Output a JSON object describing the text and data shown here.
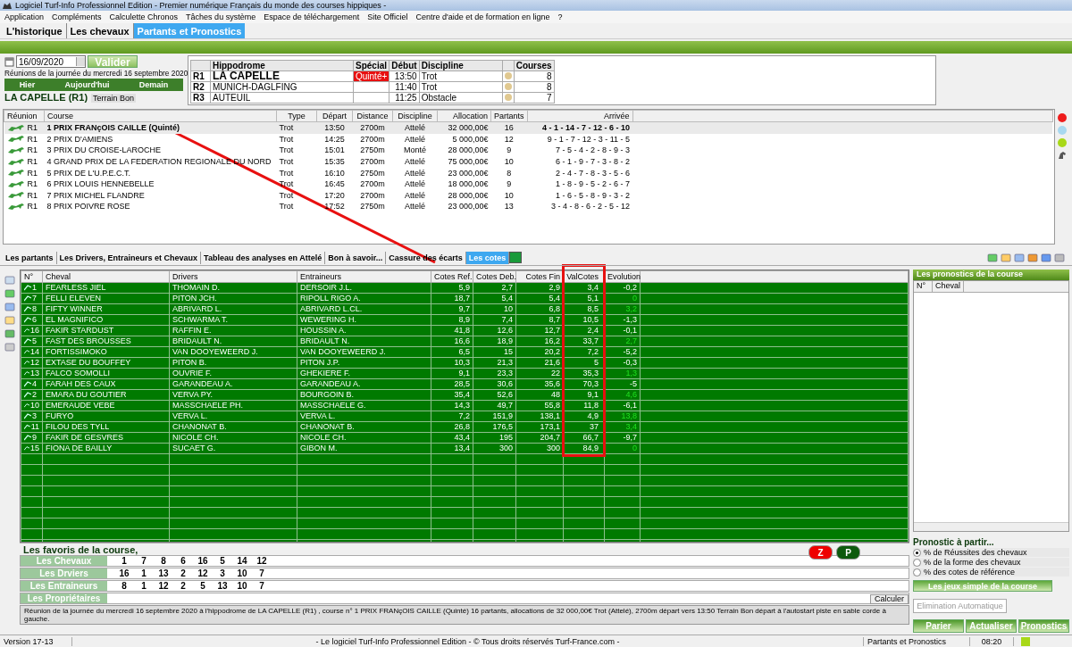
{
  "window": {
    "title": "Logiciel Turf-Info Professionnel Edition - Premier numérique Français du monde des courses hippiques -"
  },
  "menu": [
    "Application",
    "Compléments",
    "Calculette Chronos",
    "Tâches du système",
    "Espace de téléchargement",
    "Site Officiel",
    "Centre d'aide et de formation en ligne",
    "?"
  ],
  "main_tabs": [
    {
      "label": "L'historique",
      "selected": false
    },
    {
      "label": "Les chevaux",
      "selected": false
    },
    {
      "label": "Partants et Pronostics",
      "selected": true
    }
  ],
  "date_field": {
    "value": "16/09/2020",
    "button": "Valider"
  },
  "day_text": "Réunions de la journée du mercredi 16 septembre 2020",
  "day_buttons": [
    "Hier",
    "Aujourd'hui",
    "Demain"
  ],
  "meeting_title": "LA CAPELLE (R1)",
  "terrain": "Terrain Bon",
  "meetings": {
    "columns": [
      "Hippodrome",
      "Spécial",
      "Début",
      "Discipline",
      "Courses"
    ],
    "rows": [
      {
        "code": "R1",
        "hippodrome": "LA CAPELLE",
        "special": "Quinté+",
        "debut": "13:50",
        "discipline": "Trot",
        "color": "#e0c890",
        "courses": "8",
        "selected": true
      },
      {
        "code": "R2",
        "hippodrome": "MUNICH-DAGLFING",
        "debut": "11:40",
        "discipline": "Trot",
        "color": "#e0c890",
        "courses": "8",
        "selected": false
      },
      {
        "code": "R3",
        "hippodrome": "AUTEUIL",
        "debut": "11:25",
        "discipline": "Obstacle",
        "color": "#e0c890",
        "courses": "7",
        "selected": false
      }
    ]
  },
  "races": {
    "columns": [
      "Réunion",
      "Course",
      "Type",
      "Départ",
      "Distance",
      "Discipline",
      "Allocation",
      "Partants",
      "Arrivée"
    ],
    "rows": [
      {
        "reunion": "R1",
        "course": "1 PRIX FRANçOIS CAILLE (Quinté)",
        "type": "Trot",
        "depart": "13:50",
        "distance": "2700m",
        "discipline": "Attelé",
        "allocation": "32 000,00€",
        "partants": "16",
        "arrivee": "4 - 1 - 14 - 7 - 12 - 6 - 10",
        "selected": true
      },
      {
        "reunion": "R1",
        "course": "2 PRIX D'AMIENS",
        "type": "Trot",
        "depart": "14:25",
        "distance": "2700m",
        "discipline": "Attelé",
        "allocation": "5 000,00€",
        "partants": "12",
        "arrivee": "9 - 1 - 7 - 12 - 3 - 11 - 5",
        "selected": false
      },
      {
        "reunion": "R1",
        "course": "3 PRIX DU CROISE-LAROCHE",
        "type": "Trot",
        "depart": "15:01",
        "distance": "2750m",
        "discipline": "Monté",
        "allocation": "28 000,00€",
        "partants": "9",
        "arrivee": "7 - 5 - 4 - 2 - 8 - 9 - 3",
        "selected": false
      },
      {
        "reunion": "R1",
        "course": "4 GRAND PRIX DE LA FEDERATION REGIONALE DU NORD",
        "type": "Trot",
        "depart": "15:35",
        "distance": "2700m",
        "discipline": "Attelé",
        "allocation": "75 000,00€",
        "partants": "10",
        "arrivee": "6 - 1 - 9 - 7 - 3 - 8 - 2",
        "selected": false
      },
      {
        "reunion": "R1",
        "course": "5 PRIX DE L'U.P.E.C.T.",
        "type": "Trot",
        "depart": "16:10",
        "distance": "2750m",
        "discipline": "Attelé",
        "allocation": "23 000,00€",
        "partants": "8",
        "arrivee": "2 - 4 - 7 - 8 - 3 - 5 - 6",
        "selected": false
      },
      {
        "reunion": "R1",
        "course": "6 PRIX LOUIS HENNEBELLE",
        "type": "Trot",
        "depart": "16:45",
        "distance": "2700m",
        "discipline": "Attelé",
        "allocation": "18 000,00€",
        "partants": "9",
        "arrivee": "1 - 8 - 9 - 5 - 2 - 6 - 7",
        "selected": false
      },
      {
        "reunion": "R1",
        "course": "7 PRIX MICHEL FLANDRE",
        "type": "Trot",
        "depart": "17:20",
        "distance": "2700m",
        "discipline": "Attelé",
        "allocation": "28 000,00€",
        "partants": "10",
        "arrivee": "1 - 6 - 5 - 8 - 9 - 3 - 2",
        "selected": false
      },
      {
        "reunion": "R1",
        "course": "8 PRIX POIVRE ROSE",
        "type": "Trot",
        "depart": "17:52",
        "distance": "2750m",
        "discipline": "Attelé",
        "allocation": "23 000,00€",
        "partants": "13",
        "arrivee": "3 - 4 - 8 - 6 - 2 - 5 - 12",
        "selected": false
      }
    ]
  },
  "status_dots": [
    {
      "color": "#ee1c1c"
    },
    {
      "color": "#a8d8f0"
    },
    {
      "color": "#a8d818"
    }
  ],
  "sub_tabs": [
    {
      "label": "Les partants",
      "selected": false
    },
    {
      "label": "Les Drivers, Entraineurs et Chevaux",
      "selected": false
    },
    {
      "label": "Tableau des analyses en Attelé",
      "selected": false
    },
    {
      "label": "Bon à savoir...",
      "selected": false
    },
    {
      "label": "Cassure des écarts",
      "selected": false
    },
    {
      "label": "Les cotes",
      "selected": true
    }
  ],
  "odds": {
    "columns": [
      "N°",
      "Cheval",
      "Drivers",
      "Entraineurs",
      "Cotes Ref.",
      "Cotes Deb.",
      "Cotes Fin",
      "ValCotes",
      "Evolution"
    ],
    "rows": [
      {
        "num": "1",
        "cheval": "FEARLESS JIEL",
        "driver": "THOMAIN D.",
        "entraineur": "DERSOIR J.L.",
        "ref": "5,9",
        "deb": "2,7",
        "fin": "2,9",
        "val": "3,4",
        "evolution": "-0,2",
        "positive": false
      },
      {
        "num": "7",
        "cheval": "FELLI ELEVEN",
        "driver": "PITON JCH.",
        "entraineur": "RIPOLL RIGO A.",
        "ref": "18,7",
        "deb": "5,4",
        "fin": "5,4",
        "val": "5,1",
        "evolution": "0",
        "positive": true
      },
      {
        "num": "8",
        "cheval": "FIFTY WINNER",
        "driver": "ABRIVARD L.",
        "entraineur": "ABRIVARD L.CL.",
        "ref": "9,7",
        "deb": "10",
        "fin": "6,8",
        "val": "8,5",
        "evolution": "3,2",
        "positive": true
      },
      {
        "num": "6",
        "cheval": "EL MAGNIFICO",
        "driver": "SCHWARMA T.",
        "entraineur": "WEWERING H.",
        "ref": "8,9",
        "deb": "7,4",
        "fin": "8,7",
        "val": "10,5",
        "evolution": "-1,3",
        "positive": false
      },
      {
        "num": "16",
        "cheval": "FAKIR STARDUST",
        "driver": "RAFFIN E.",
        "entraineur": "HOUSSIN A.",
        "ref": "41,8",
        "deb": "12,6",
        "fin": "12,7",
        "val": "2,4",
        "evolution": "-0,1",
        "positive": false
      },
      {
        "num": "5",
        "cheval": "FAST DES BROUSSES",
        "driver": "BRIDAULT N.",
        "entraineur": "BRIDAULT N.",
        "ref": "16,6",
        "deb": "18,9",
        "fin": "16,2",
        "val": "33,7",
        "evolution": "2,7",
        "positive": true
      },
      {
        "num": "14",
        "cheval": "FORTISSIMOKO",
        "driver": "VAN DOOYEWEERD J.",
        "entraineur": "VAN DOOYEWEERD J.",
        "ref": "6,5",
        "deb": "15",
        "fin": "20,2",
        "val": "7,2",
        "evolution": "-5,2",
        "positive": false
      },
      {
        "num": "12",
        "cheval": "EXTASE DU BOUFFEY",
        "driver": "PITON B.",
        "entraineur": "PITON J.P.",
        "ref": "10,3",
        "deb": "21,3",
        "fin": "21,6",
        "val": "5",
        "evolution": "-0,3",
        "positive": false
      },
      {
        "num": "13",
        "cheval": "FALCO SOMOLLI",
        "driver": "OUVRIE F.",
        "entraineur": "GHEKIERE F.",
        "ref": "9,1",
        "deb": "23,3",
        "fin": "22",
        "val": "35,3",
        "evolution": "1,3",
        "positive": true
      },
      {
        "num": "4",
        "cheval": "FARAH DES CAUX",
        "driver": "GARANDEAU A.",
        "entraineur": "GARANDEAU A.",
        "ref": "28,5",
        "deb": "30,6",
        "fin": "35,6",
        "val": "70,3",
        "evolution": "-5",
        "positive": false
      },
      {
        "num": "2",
        "cheval": "EMARA DU GOUTIER",
        "driver": "VERVA PY.",
        "entraineur": "BOURGOIN B.",
        "ref": "35,4",
        "deb": "52,6",
        "fin": "48",
        "val": "9,1",
        "evolution": "4,6",
        "positive": true
      },
      {
        "num": "10",
        "cheval": "EMERAUDE VEBE",
        "driver": "MASSCHAELE PH.",
        "entraineur": "MASSCHAELE G.",
        "ref": "14,3",
        "deb": "49,7",
        "fin": "55,8",
        "val": "11,8",
        "evolution": "-6,1",
        "positive": false
      },
      {
        "num": "3",
        "cheval": "FURYO",
        "driver": "VERVA L.",
        "entraineur": "VERVA L.",
        "ref": "7,2",
        "deb": "151,9",
        "fin": "138,1",
        "val": "4,9",
        "evolution": "13,8",
        "positive": true
      },
      {
        "num": "11",
        "cheval": "FILOU DES TYLL",
        "driver": "CHANONAT B.",
        "entraineur": "CHANONAT B.",
        "ref": "26,8",
        "deb": "176,5",
        "fin": "173,1",
        "val": "37",
        "evolution": "3,4",
        "positive": true
      },
      {
        "num": "9",
        "cheval": "FAKIR DE GESVRES",
        "driver": "NICOLE CH.",
        "entraineur": "NICOLE CH.",
        "ref": "43,4",
        "deb": "195",
        "fin": "204,7",
        "val": "66,7",
        "evolution": "-9,7",
        "positive": false
      },
      {
        "num": "15",
        "cheval": "FIONA DE BAILLY",
        "driver": "SUCAET G.",
        "entraineur": "GIBON M.",
        "ref": "13,4",
        "deb": "300",
        "fin": "300",
        "val": "84,9",
        "evolution": "0",
        "positive": true
      }
    ]
  },
  "favorites": {
    "title": "Les favoris de la course,",
    "badges": [
      "Z",
      "P"
    ],
    "rows": [
      {
        "label": "Les Chevaux",
        "values": [
          "1",
          "7",
          "8",
          "6",
          "16",
          "5",
          "14",
          "12"
        ]
      },
      {
        "label": "Les Drviers",
        "values": [
          "16",
          "1",
          "13",
          "2",
          "12",
          "3",
          "10",
          "7"
        ]
      },
      {
        "label": "Les Entraineurs",
        "values": [
          "8",
          "1",
          "12",
          "2",
          "5",
          "13",
          "10",
          "7"
        ]
      },
      {
        "label": "Les Propriétaires",
        "values": []
      }
    ],
    "calc_button": "Calculer"
  },
  "summary": "Réunion de la journée du mercredi 16 septembre 2020 à l'hippodrome de  LA CAPELLE (R1) , course n° 1 PRIX FRANçOIS CAILLE (Quinté) 16 partants, allocations de 32 000,00€ Trot (Attelé), 2700m départ vers 13:50 Terrain Bon départ à l'autostart piste en sable corde à gauche.",
  "pronostics": {
    "title": "Les pronostics de la course",
    "columns": [
      "N°",
      "Cheval"
    ],
    "group_title": "Pronostic à partir...",
    "options": [
      {
        "label": "% de Réussites des chevaux",
        "selected": true
      },
      {
        "label": "% de la forme des chevaux",
        "selected": false
      },
      {
        "label": "% des cotes de référence",
        "selected": false
      }
    ],
    "jeux_button": "Les jeux simple de la course",
    "elimination": {
      "label": "Elimination Automatique",
      "disabled": true
    },
    "actions": [
      "Parier",
      "Actualiser",
      "Pronostics"
    ]
  },
  "status_bar": [
    "Version 17-13",
    "- Le logiciel Turf-Info Professionnel Edition - © Tous droits réservés Turf-France.com -",
    "Partants et Pronostics",
    "08:20"
  ]
}
